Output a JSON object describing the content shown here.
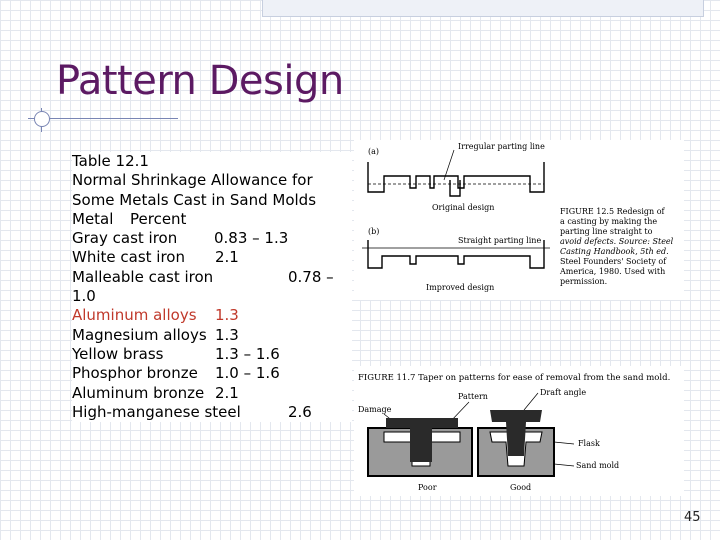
{
  "slide": {
    "title": "Pattern Design",
    "page_number": "45"
  },
  "table": {
    "caption": "Table 12.1",
    "heading_1": "Normal Shrinkage Allowance for",
    "heading_2": "Some Metals Cast in Sand Molds",
    "col_metal": "Metal",
    "col_percent": "Percent",
    "rows": [
      {
        "metal": "Gray cast iron",
        "percent": "0.83 – 1.3"
      },
      {
        "metal": "White cast iron",
        "percent": "2.1"
      },
      {
        "metal": "Malleable cast iron",
        "percent": "0.78 –"
      },
      {
        "metal": "",
        "percent": "1.0"
      },
      {
        "metal": "Aluminum alloys",
        "percent": "1.3"
      },
      {
        "metal": "Magnesium alloys",
        "percent": "1.3"
      },
      {
        "metal": "Yellow brass",
        "percent": "1.3 – 1.6"
      },
      {
        "metal": "Phosphor bronze",
        "percent": "1.0 – 1.6"
      },
      {
        "metal": "Aluminum bronze",
        "percent": "2.1"
      },
      {
        "metal": "High-manganese steel",
        "percent": "2.6"
      }
    ]
  },
  "figure_top": {
    "label_a": "(a)",
    "label_b": "(b)",
    "irregular": "Irregular parting line",
    "original": "Original design",
    "straight": "Straight parting line",
    "improved": "Improved design",
    "caption_lines": [
      "FIGURE 12.5   Redesign of",
      "a casting by making the",
      "parting line straight to",
      "avoid defects. Source: Steel",
      "Casting Handbook, 5th ed.",
      "Steel Founders' Society of",
      "America, 1980. Used with",
      "permission."
    ]
  },
  "figure_bottom": {
    "caption": "FIGURE 11.7   Taper on patterns for ease of removal from the sand mold.",
    "pattern": "Pattern",
    "draft": "Draft angle",
    "damage": "Damage",
    "flask": "Flask",
    "sand": "Sand mold",
    "poor": "Poor",
    "good": "Good"
  }
}
